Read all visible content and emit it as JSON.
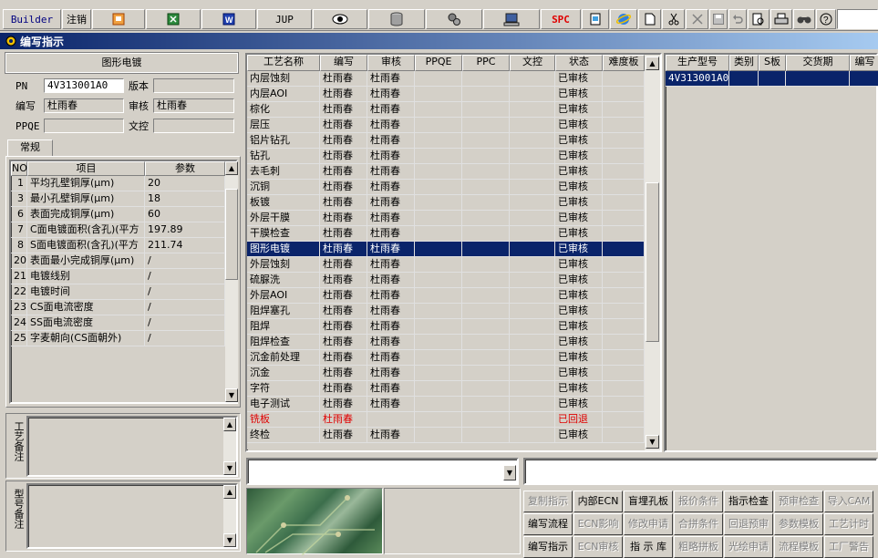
{
  "toolbar": {
    "builder": "Builder",
    "logout": "注销",
    "jup": "JUP",
    "spc": "SPC",
    "icons": [
      "ppt-icon",
      "excel-icon",
      "word-icon",
      "eye-icon",
      "database-icon",
      "settings-icon",
      "computer-icon",
      "file-icon",
      "ie-icon",
      "new-doc-icon",
      "cut-icon",
      "close-icon",
      "save-icon",
      "undo-icon",
      "print-preview-icon",
      "print-icon",
      "find-icon",
      "help-icon"
    ]
  },
  "window": {
    "title": "编写指示"
  },
  "left": {
    "section_title": "图形电镀",
    "pn_label": "PN",
    "pn_value": "4V313001A0",
    "version_label": "版本",
    "version_value": "",
    "writer_label": "编写",
    "writer_value": "杜雨春",
    "reviewer_label": "审核",
    "reviewer_value": "杜雨春",
    "ppqe_label": "PPQE",
    "ppqe_value": "",
    "doccheck_label": "文控",
    "doccheck_value": "",
    "tab": "常规",
    "param_headers": {
      "no": "NO",
      "item": "项目",
      "param": "参数"
    },
    "params": [
      {
        "no": "1",
        "item": "平均孔壁铜厚(μm)",
        "param": "20"
      },
      {
        "no": "3",
        "item": "最小孔壁铜厚(μm)",
        "param": "18"
      },
      {
        "no": "6",
        "item": "表面完成铜厚(μm)",
        "param": "60"
      },
      {
        "no": "7",
        "item": "C面电镀面积(含孔)(平方",
        "param": "197.89"
      },
      {
        "no": "8",
        "item": "S面电镀面积(含孔)(平方",
        "param": "211.74"
      },
      {
        "no": "20",
        "item": "表面最小完成铜厚(μm)",
        "param": "/"
      },
      {
        "no": "21",
        "item": "电镀线别",
        "param": "/"
      },
      {
        "no": "22",
        "item": "电镀时间",
        "param": "/"
      },
      {
        "no": "23",
        "item": "CS面电流密度",
        "param": "/"
      },
      {
        "no": "24",
        "item": "SS面电流密度",
        "param": "/"
      },
      {
        "no": "25",
        "item": "字麦朝向(CS面朝外)",
        "param": "/"
      }
    ],
    "process_note_label": "工艺备注",
    "model_note_label": "型号备注"
  },
  "process": {
    "headers": [
      "工艺名称",
      "编写",
      "审核",
      "PPQE",
      "PPC",
      "文控",
      "状态",
      "难度板"
    ],
    "rows": [
      {
        "name": "内层蚀刻",
        "w": "杜雨春",
        "r": "杜雨春",
        "s": "已审核"
      },
      {
        "name": "内层AOI",
        "w": "杜雨春",
        "r": "杜雨春",
        "s": "已审核"
      },
      {
        "name": "棕化",
        "w": "杜雨春",
        "r": "杜雨春",
        "s": "已审核"
      },
      {
        "name": "层压",
        "w": "杜雨春",
        "r": "杜雨春",
        "s": "已审核"
      },
      {
        "name": "铝片钻孔",
        "w": "杜雨春",
        "r": "杜雨春",
        "s": "已审核"
      },
      {
        "name": "钻孔",
        "w": "杜雨春",
        "r": "杜雨春",
        "s": "已审核"
      },
      {
        "name": "去毛刺",
        "w": "杜雨春",
        "r": "杜雨春",
        "s": "已审核"
      },
      {
        "name": "沉铜",
        "w": "杜雨春",
        "r": "杜雨春",
        "s": "已审核"
      },
      {
        "name": "板镀",
        "w": "杜雨春",
        "r": "杜雨春",
        "s": "已审核"
      },
      {
        "name": "外层干膜",
        "w": "杜雨春",
        "r": "杜雨春",
        "s": "已审核"
      },
      {
        "name": "干膜检查",
        "w": "杜雨春",
        "r": "杜雨春",
        "s": "已审核"
      },
      {
        "name": "图形电镀",
        "w": "杜雨春",
        "r": "杜雨春",
        "s": "已审核",
        "selected": true
      },
      {
        "name": "外层蚀刻",
        "w": "杜雨春",
        "r": "杜雨春",
        "s": "已审核"
      },
      {
        "name": "硫脲洗",
        "w": "杜雨春",
        "r": "杜雨春",
        "s": "已审核"
      },
      {
        "name": "外层AOI",
        "w": "杜雨春",
        "r": "杜雨春",
        "s": "已审核"
      },
      {
        "name": "阻焊塞孔",
        "w": "杜雨春",
        "r": "杜雨春",
        "s": "已审核"
      },
      {
        "name": "阻焊",
        "w": "杜雨春",
        "r": "杜雨春",
        "s": "已审核"
      },
      {
        "name": "阻焊检查",
        "w": "杜雨春",
        "r": "杜雨春",
        "s": "已审核"
      },
      {
        "name": "沉金前处理",
        "w": "杜雨春",
        "r": "杜雨春",
        "s": "已审核"
      },
      {
        "name": "沉金",
        "w": "杜雨春",
        "r": "杜雨春",
        "s": "已审核"
      },
      {
        "name": "字符",
        "w": "杜雨春",
        "r": "杜雨春",
        "s": "已审核"
      },
      {
        "name": "电子测试",
        "w": "杜雨春",
        "r": "杜雨春",
        "s": "已审核"
      },
      {
        "name": "铣板",
        "w": "杜雨春",
        "r": "",
        "s": "已回退",
        "rejected": true
      },
      {
        "name": "终检",
        "w": "杜雨春",
        "r": "杜雨春",
        "s": "已审核"
      }
    ]
  },
  "models": {
    "headers": [
      "生产型号",
      "类别",
      "S板",
      "交货期",
      "编写"
    ],
    "rows": [
      {
        "model": "4V313001A0"
      }
    ]
  },
  "buttons": [
    [
      "复制指示",
      "内部ECN",
      "盲埋孔板",
      "报价条件",
      "指示检查",
      "预审检查",
      "导入CAM"
    ],
    [
      "编写流程",
      "ECN影响",
      "修改申请",
      "合拼条件",
      "回退预审",
      "参数模板",
      "工艺计时"
    ],
    [
      "编写指示",
      "ECN审核",
      "指 示 库",
      "粗略拼板",
      "光绘申请",
      "流程模板",
      "工厂警告"
    ]
  ],
  "button_enabled": [
    [
      false,
      true,
      true,
      false,
      true,
      false,
      false
    ],
    [
      true,
      false,
      false,
      false,
      false,
      false,
      false
    ],
    [
      true,
      false,
      true,
      false,
      false,
      false,
      false
    ]
  ]
}
